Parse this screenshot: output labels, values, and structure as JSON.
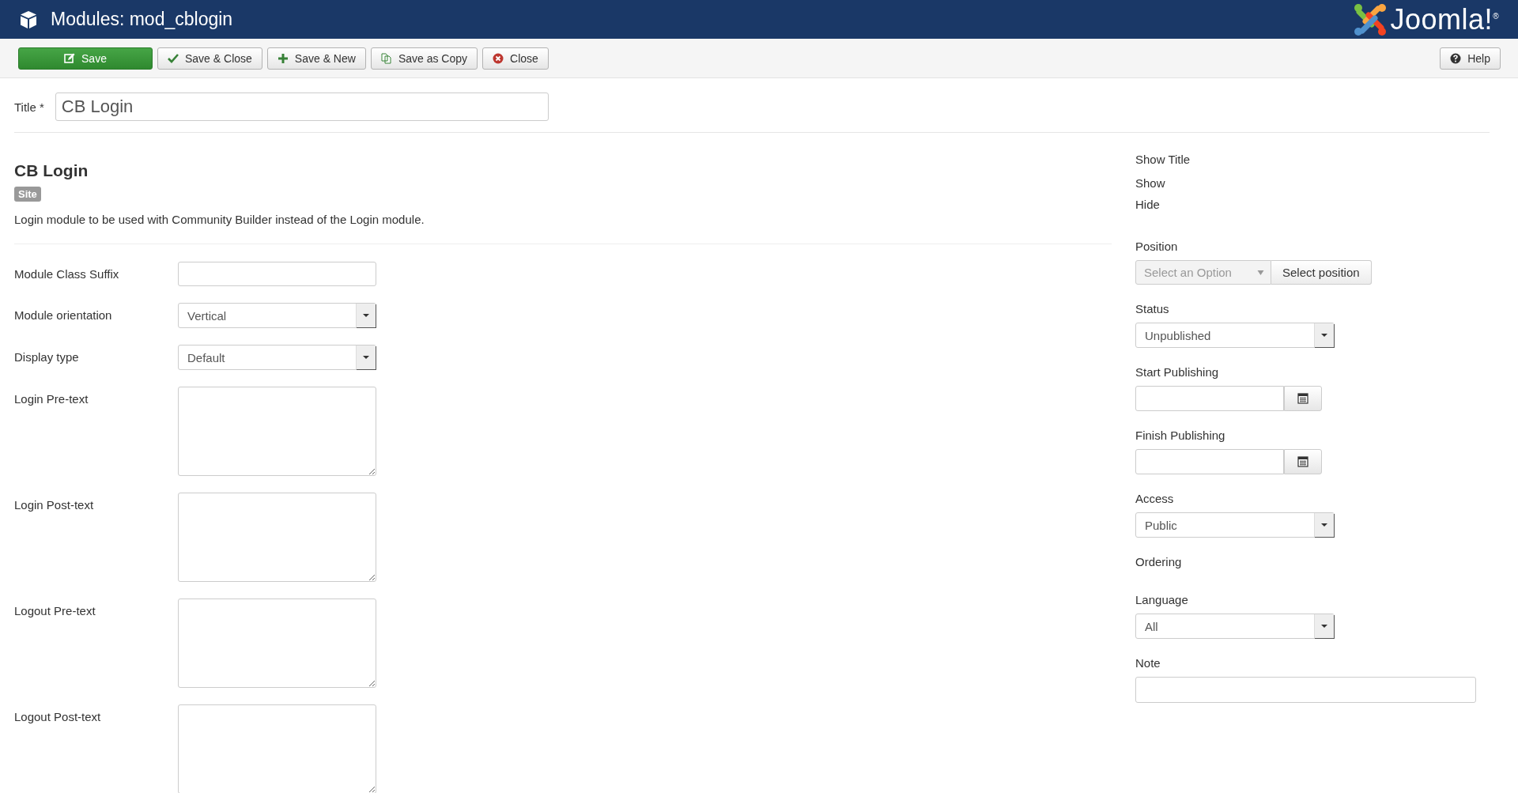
{
  "header": {
    "title": "Modules: mod_cblogin",
    "logo_text": "Joomla!$^{®}$"
  },
  "toolbar": {
    "buttons": [
      {
        "label": "Save",
        "kind": "save"
      },
      {
        "label": "Save & Close",
        "kind": "save-close"
      },
      {
        "label": "Save & New",
        "kind": "save-new"
      },
      {
        "label": "Save as Copy",
        "kind": "save-copy"
      },
      {
        "label": "Close",
        "kind": "close"
      }
    ],
    "help": {
      "label": "Help"
    }
  },
  "title_field": {
    "label": "Title *",
    "value": "CB Login"
  },
  "module": {
    "heading": "CB Login",
    "badge": "Site",
    "description": "Login module to be used with Community Builder instead of the Login module."
  },
  "fields": [
    {
      "label": "Module Class Suffix",
      "kind": "text"
    },
    {
      "label": "Module orientation",
      "kind": "select",
      "value": "Vertical"
    },
    {
      "label": "Display type",
      "kind": "select",
      "value": "Default"
    },
    {
      "label": "Login Pre-text",
      "kind": "textarea"
    },
    {
      "label": "Login Post-text",
      "kind": "textarea"
    },
    {
      "label": "Logout Pre-text",
      "kind": "textarea"
    },
    {
      "label": "Logout Post-text",
      "kind": "textarea"
    }
  ],
  "sidebar": {
    "show_title": {
      "label": "Show Title",
      "options": [
        "Show",
        "Hide"
      ]
    },
    "fields": [
      {
        "label": "Position",
        "kind": "position",
        "placeholder": "Select an Option",
        "button": "Select position"
      },
      {
        "label": "Status",
        "kind": "select",
        "value": "Unpublished"
      },
      {
        "label": "Start Publishing",
        "kind": "date"
      },
      {
        "label": "Finish Publishing",
        "kind": "date"
      },
      {
        "label": "Access",
        "kind": "select",
        "value": "Public"
      },
      {
        "label": "Ordering",
        "kind": "none"
      },
      {
        "label": "Language",
        "kind": "select",
        "value": "All"
      },
      {
        "label": "Note",
        "kind": "text"
      }
    ]
  }
}
